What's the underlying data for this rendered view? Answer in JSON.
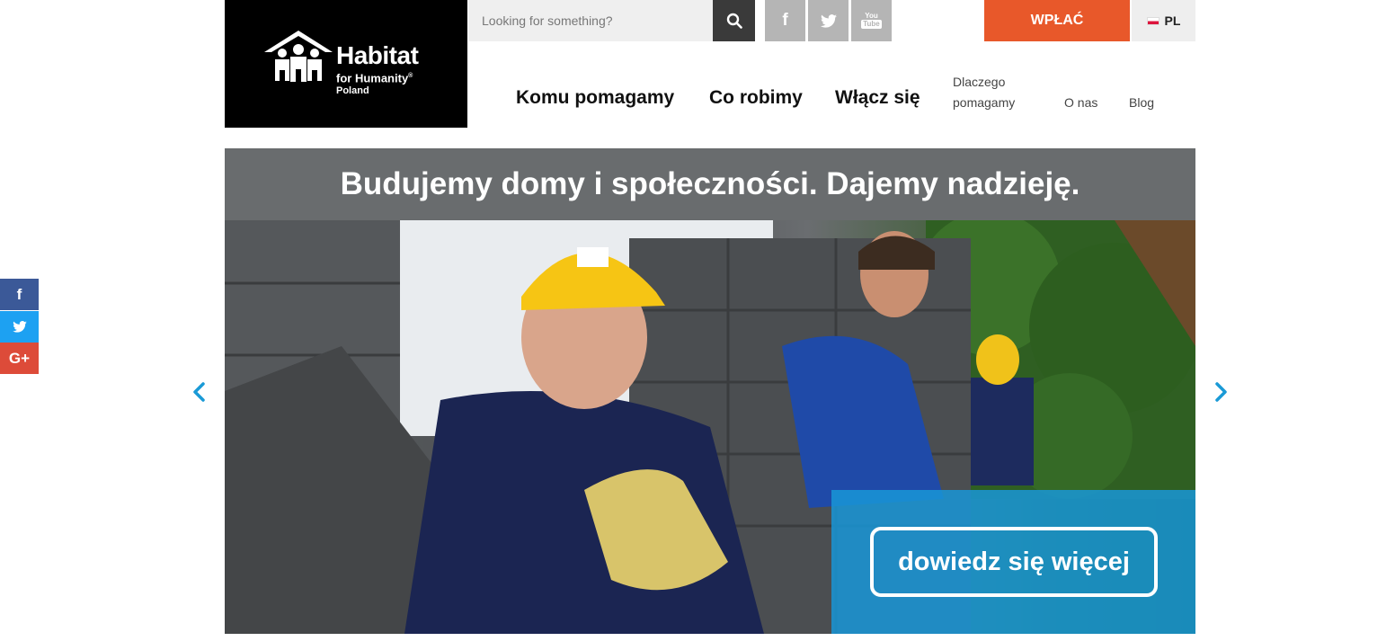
{
  "logo": {
    "title": "Habitat",
    "subtitle": "for Humanity",
    "registered": "®",
    "country": "Poland"
  },
  "search": {
    "placeholder": "Looking for something?",
    "icon": "search-icon"
  },
  "social_top": [
    {
      "name": "facebook-icon",
      "glyph": "f"
    },
    {
      "name": "twitter-icon",
      "glyph": "t"
    },
    {
      "name": "youtube-icon",
      "glyph": "You Tube"
    }
  ],
  "donate": {
    "label": "WPŁAĆ",
    "color": "#e8582a"
  },
  "language": {
    "label": "PL"
  },
  "nav": {
    "main": [
      "Komu pomagamy",
      "Co robimy",
      "Włącz się"
    ],
    "secondary": {
      "why_line1": "Dlaczego",
      "why_line2": "pomagamy",
      "about": "O nas",
      "blog": "Blog"
    }
  },
  "hero": {
    "headline": "Budujemy domy i społeczności. Dajemy nadzieję.",
    "cta_label": "dowiedz się więcej",
    "cta_color": "#1996d7",
    "band_color": "#696c6e"
  },
  "carousel": {
    "prev_icon": "chevron-left-icon",
    "next_icon": "chevron-right-icon",
    "arrow_color": "#1a9ad6"
  },
  "share": {
    "facebook": "f",
    "twitter": "t",
    "google_plus": "G+"
  }
}
